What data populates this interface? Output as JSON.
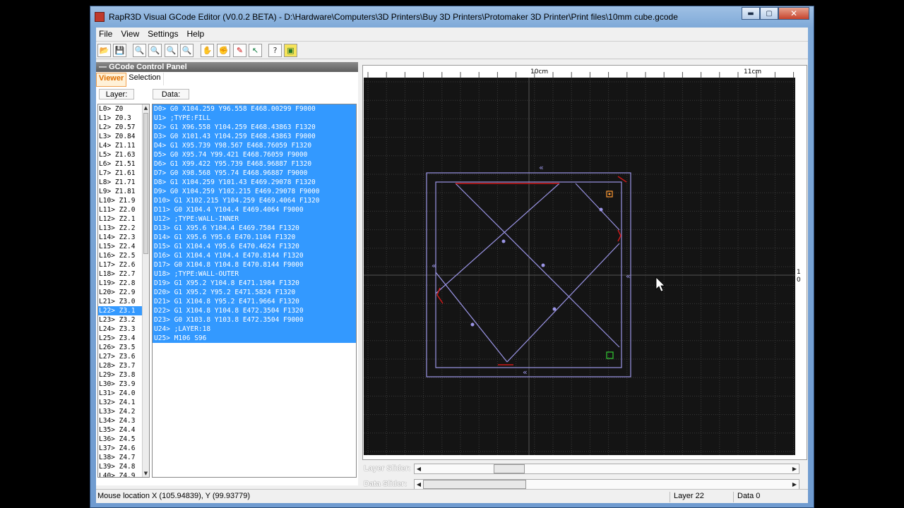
{
  "window": {
    "title": "RapR3D Visual GCode Editor (V0.0.2 BETA) - D:\\Hardware\\Computers\\3D Printers\\Buy 3D Printers\\Protomaker 3D Printer\\Print files\\10mm cube.gcode",
    "min_label": "▬",
    "max_label": "▢",
    "close_label": "✕"
  },
  "menu": [
    "File",
    "View",
    "Settings",
    "Help"
  ],
  "toolbar": [
    {
      "icon": "open-folder-icon",
      "glyph": "📂"
    },
    {
      "icon": "save-icon",
      "glyph": "💾"
    },
    {
      "icon": "zoom-in-icon",
      "glyph": "🔍"
    },
    {
      "icon": "zoom-out-icon",
      "glyph": "🔍"
    },
    {
      "icon": "zoom-fit-icon",
      "glyph": "🔍"
    },
    {
      "icon": "zoom-reset-icon",
      "glyph": "🔍"
    },
    {
      "icon": "hand-pan-icon",
      "glyph": "✋"
    },
    {
      "icon": "hand-grab-icon",
      "glyph": "✊"
    },
    {
      "icon": "pen-draw-icon",
      "glyph": "✎"
    },
    {
      "icon": "select-arrow-icon",
      "glyph": "↖"
    },
    {
      "icon": "help-icon",
      "glyph": "?"
    },
    {
      "icon": "layer-export-icon",
      "glyph": "▣"
    }
  ],
  "panel": {
    "title": "GCode Control Panel",
    "tabs": [
      "Viewer",
      "Selection"
    ],
    "layer_header": "Layer:",
    "data_header": "Data:",
    "selected_layer_index": 22,
    "layers": [
      "L0> Z0",
      "L1> Z0.3",
      "L2> Z0.57",
      "L3> Z0.84",
      "L4> Z1.11",
      "L5> Z1.63",
      "L6> Z1.51",
      "L7> Z1.61",
      "L8> Z1.71",
      "L9> Z1.81",
      "L10> Z1.9",
      "L11> Z2.0",
      "L12> Z2.1",
      "L13> Z2.2",
      "L14> Z2.3",
      "L15> Z2.4",
      "L16> Z2.5",
      "L17> Z2.6",
      "L18> Z2.7",
      "L19> Z2.8",
      "L20> Z2.9",
      "L21> Z3.0",
      "L22> Z3.1",
      "L23> Z3.2",
      "L24> Z3.3",
      "L25> Z3.4",
      "L26> Z3.5",
      "L27> Z3.6",
      "L28> Z3.7",
      "L29> Z3.8",
      "L30> Z3.9",
      "L31> Z4.0",
      "L32> Z4.1",
      "L33> Z4.2",
      "L34> Z4.3",
      "L35> Z4.4",
      "L36> Z4.5",
      "L37> Z4.6",
      "L38> Z4.7",
      "L39> Z4.8",
      "L40> Z4.9"
    ],
    "data": [
      "D0> G0 X104.259 Y96.558 E468.00299 F9000",
      "U1> ;TYPE:FILL",
      "D2> G1 X96.558 Y104.259 E468.43863 F1320",
      "D3> G0 X101.43 Y104.259 E468.43863 F9000",
      "D4> G1 X95.739 Y98.567 E468.76059 F1320",
      "D5> G0 X95.74 Y99.421 E468.76059 F9000",
      "D6> G1 X99.422 Y95.739 E468.96887 F1320",
      "D7> G0 X98.568 Y95.74 E468.96887 F9000",
      "D8> G1 X104.259 Y101.43 E469.29078 F1320",
      "D9> G0 X104.259 Y102.215 E469.29078 F9000",
      "D10> G1 X102.215 Y104.259 E469.4064 F1320",
      "D11> G0 X104.4 Y104.4 E469.4064 F9000",
      "U12> ;TYPE:WALL-INNER",
      "D13> G1 X95.6 Y104.4 E469.7584 F1320",
      "D14> G1 X95.6 Y95.6 E470.1104 F1320",
      "D15> G1 X104.4 Y95.6 E470.4624 F1320",
      "D16> G1 X104.4 Y104.4 E470.8144 F1320",
      "D17> G0 X104.8 Y104.8 E470.8144 F9000",
      "U18> ;TYPE:WALL-OUTER",
      "D19> G1 X95.2 Y104.8 E471.1984 F1320",
      "D20> G1 X95.2 Y95.2 E471.5824 F1320",
      "D21> G1 X104.8 Y95.2 E471.9664 F1320",
      "D22> G1 X104.8 Y104.8 E472.3504 F1320",
      "D23> G0 X103.8 Y103.8 E472.3504 F9000",
      "U24> ;LAYER:18",
      "U25> M106 S96"
    ]
  },
  "viewer": {
    "ruler_labels": [
      "10cm",
      "11cm"
    ],
    "right_ruler_labels": [
      "1",
      "0"
    ],
    "background": "#141414",
    "grid_color": "#3a3a3a",
    "path_color": "#9b95e6",
    "travel_color": "#cc1a1a",
    "start_marker_color": "#ff9933",
    "end_marker_color": "#33cc33"
  },
  "sliders": {
    "layer_label": "Layer Slider:",
    "data_label": "Data Slider:",
    "left_arrow": "◀",
    "right_arrow": "▶"
  },
  "status": {
    "mouse": "Mouse location X (105.94839), Y (99.93779)",
    "layer": "Layer 22",
    "data": "Data 0"
  }
}
